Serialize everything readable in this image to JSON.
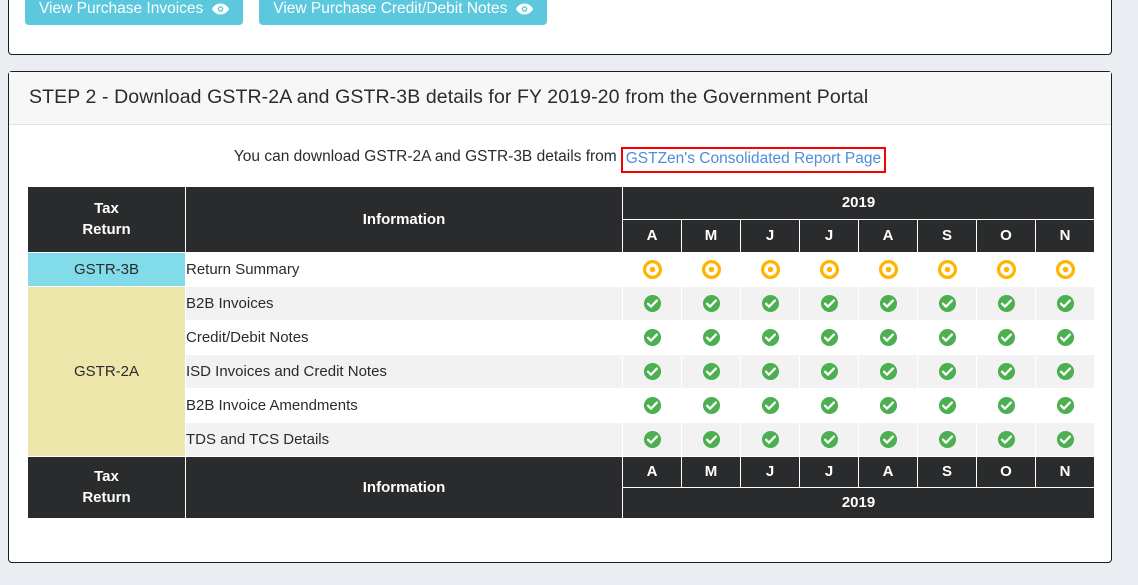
{
  "page": {
    "background_color": "#eaedf1"
  },
  "step1": {
    "buttons": [
      {
        "label": "View Purchase Invoices",
        "icon": "eye-icon"
      },
      {
        "label": "View Purchase Credit/Debit Notes",
        "icon": "eye-icon"
      }
    ],
    "button_color": "#5bc8dd"
  },
  "step2": {
    "header_title": "STEP 2 - Download GSTR-2A and GSTR-3B details for FY 2019-20 from the Government Portal",
    "intro_text": "You can download GSTR-2A and GSTR-3B details from",
    "intro_link_label": "GSTZen's Consolidated Report Page",
    "intro_link_color": "#4d8ddd",
    "intro_link_highlight_color": "#f70000"
  },
  "table": {
    "header": {
      "tax_return_line1": "Tax",
      "tax_return_line2": "Return",
      "information": "Information",
      "year": "2019",
      "months": [
        "A",
        "M",
        "J",
        "J",
        "A",
        "S",
        "O",
        "N"
      ]
    },
    "footer": {
      "tax_return_line1": "Tax",
      "tax_return_line2": "Return",
      "information": "Information",
      "year": "2019",
      "months": [
        "A",
        "M",
        "J",
        "J",
        "A",
        "S",
        "O",
        "N"
      ]
    },
    "categories": [
      {
        "label": "GSTR-3B",
        "color": "#81dbe9",
        "rowspan": 1
      },
      {
        "label": "GSTR-2A",
        "color": "#ece6ab",
        "rowspan": 5
      }
    ],
    "rows": [
      {
        "category": "GSTR-3B",
        "information": "Return Summary",
        "stripe": "white",
        "marks": [
          "dot-circle",
          "dot-circle",
          "dot-circle",
          "dot-circle",
          "dot-circle",
          "dot-circle",
          "dot-circle",
          "dot-circle"
        ]
      },
      {
        "category": "GSTR-2A",
        "information": "B2B Invoices",
        "stripe": "alt",
        "marks": [
          "check-circle",
          "check-circle",
          "check-circle",
          "check-circle",
          "check-circle",
          "check-circle",
          "check-circle",
          "check-circle"
        ]
      },
      {
        "category": "GSTR-2A",
        "information": "Credit/Debit Notes",
        "stripe": "white",
        "marks": [
          "check-circle",
          "check-circle",
          "check-circle",
          "check-circle",
          "check-circle",
          "check-circle",
          "check-circle",
          "check-circle"
        ]
      },
      {
        "category": "GSTR-2A",
        "information": "ISD Invoices and Credit Notes",
        "stripe": "alt",
        "marks": [
          "check-circle",
          "check-circle",
          "check-circle",
          "check-circle",
          "check-circle",
          "check-circle",
          "check-circle",
          "check-circle"
        ]
      },
      {
        "category": "GSTR-2A",
        "information": "B2B Invoice Amendments",
        "stripe": "white",
        "marks": [
          "check-circle",
          "check-circle",
          "check-circle",
          "check-circle",
          "check-circle",
          "check-circle",
          "check-circle",
          "check-circle"
        ]
      },
      {
        "category": "GSTR-2A",
        "information": "TDS and TCS Details",
        "stripe": "alt",
        "marks": [
          "check-circle",
          "check-circle",
          "check-circle",
          "check-circle",
          "check-circle",
          "check-circle",
          "check-circle",
          "check-circle"
        ]
      }
    ],
    "mark_colors": {
      "dot-circle": "#ffb400",
      "check-circle": "#4caf50"
    },
    "header_background": "#292b2c"
  }
}
